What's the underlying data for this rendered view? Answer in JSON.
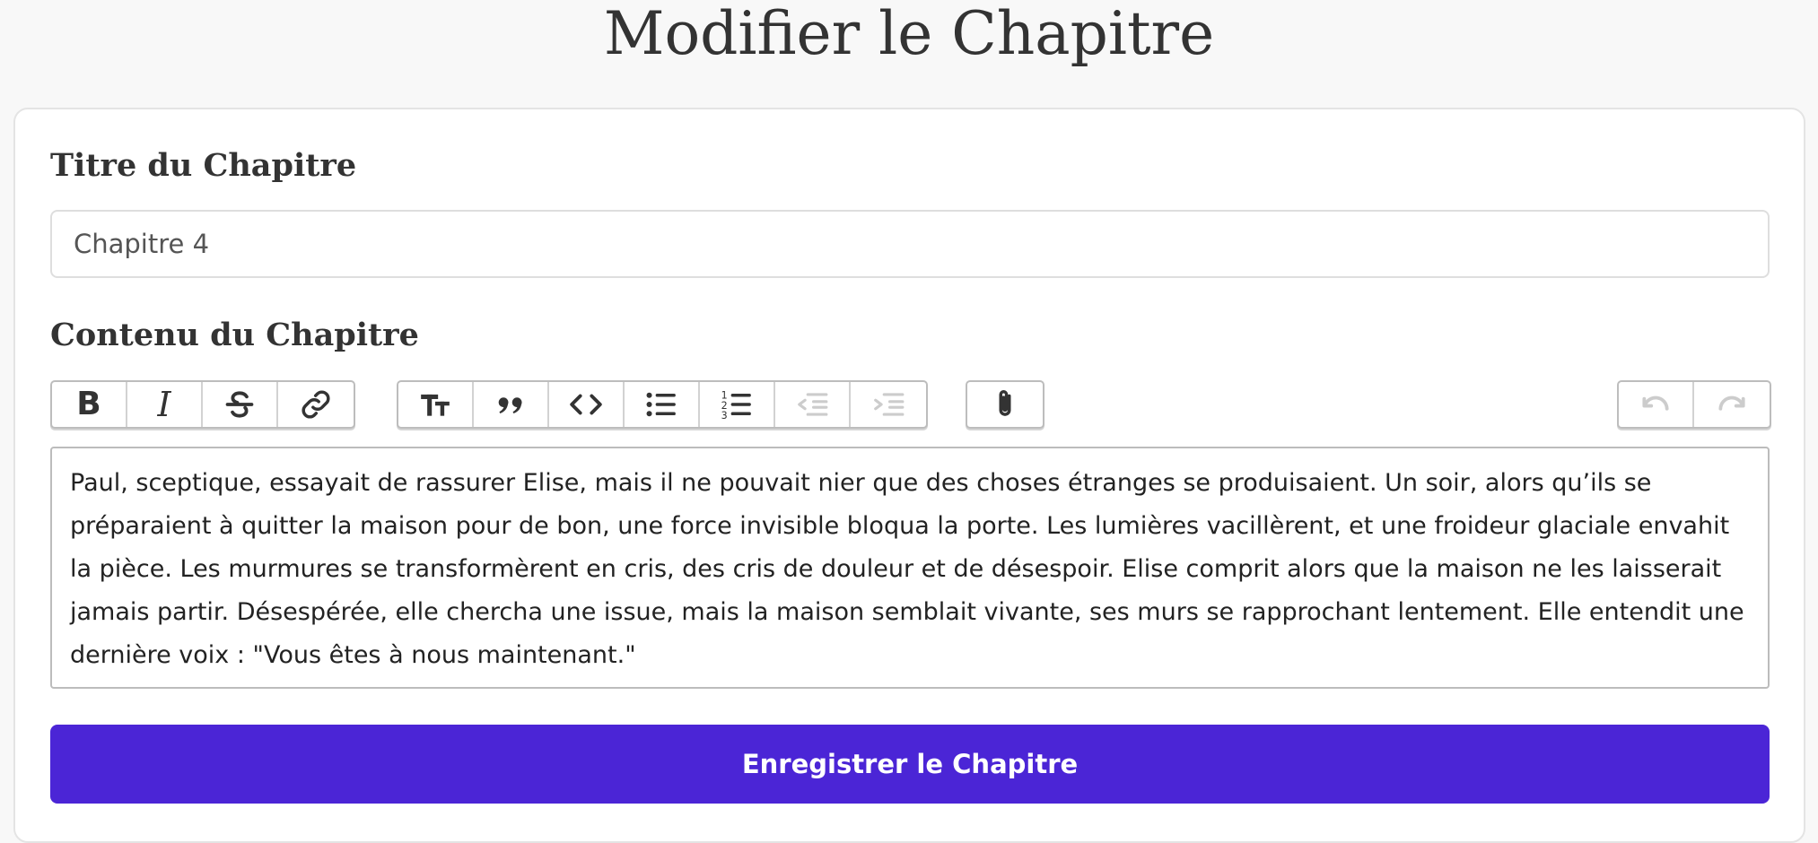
{
  "page": {
    "title": "Modifier le Chapitre"
  },
  "form": {
    "title_label": "Titre du Chapitre",
    "title_value": "Chapitre 4",
    "content_label": "Contenu du Chapitre",
    "content_text": "Paul, sceptique, essayait de rassurer Elise, mais il ne pouvait nier que des choses étranges se produisaient. Un soir, alors qu’ils se préparaient à quitter la maison pour de bon, une force invisible bloqua la porte. Les lumières vacillèrent, et une froideur glaciale envahit la pièce. Les murmures se transformèrent en cris, des cris de douleur et de désespoir. Elise comprit alors que la maison ne les laisserait jamais partir. Désespérée, elle chercha une issue, mais la maison semblait vivante, ses murs se rapprochant lentement. Elle entendit une dernière voix : \"Vous êtes à nous maintenant.\"",
    "save_label": "Enregistrer le Chapitre"
  },
  "toolbar": {
    "groups": [
      {
        "name": "text-formatting",
        "buttons": [
          "bold-icon",
          "italic-icon",
          "strikethrough-icon",
          "link-icon"
        ]
      },
      {
        "name": "block-formatting",
        "buttons": [
          "heading-icon",
          "quote-icon",
          "code-icon",
          "bullet-list-icon",
          "numbered-list-icon",
          "decrease-indent-icon",
          "increase-indent-icon"
        ]
      },
      {
        "name": "attachments",
        "buttons": [
          "attach-icon"
        ]
      },
      {
        "name": "history",
        "buttons": [
          "undo-icon",
          "redo-icon"
        ]
      }
    ],
    "disabled": [
      "decrease-indent-icon",
      "increase-indent-icon",
      "undo-icon",
      "redo-icon"
    ]
  },
  "colors": {
    "primary": "#4b25d6",
    "background": "#f8f8f8",
    "text": "#333333",
    "disabled_icon": "#cccccc"
  }
}
